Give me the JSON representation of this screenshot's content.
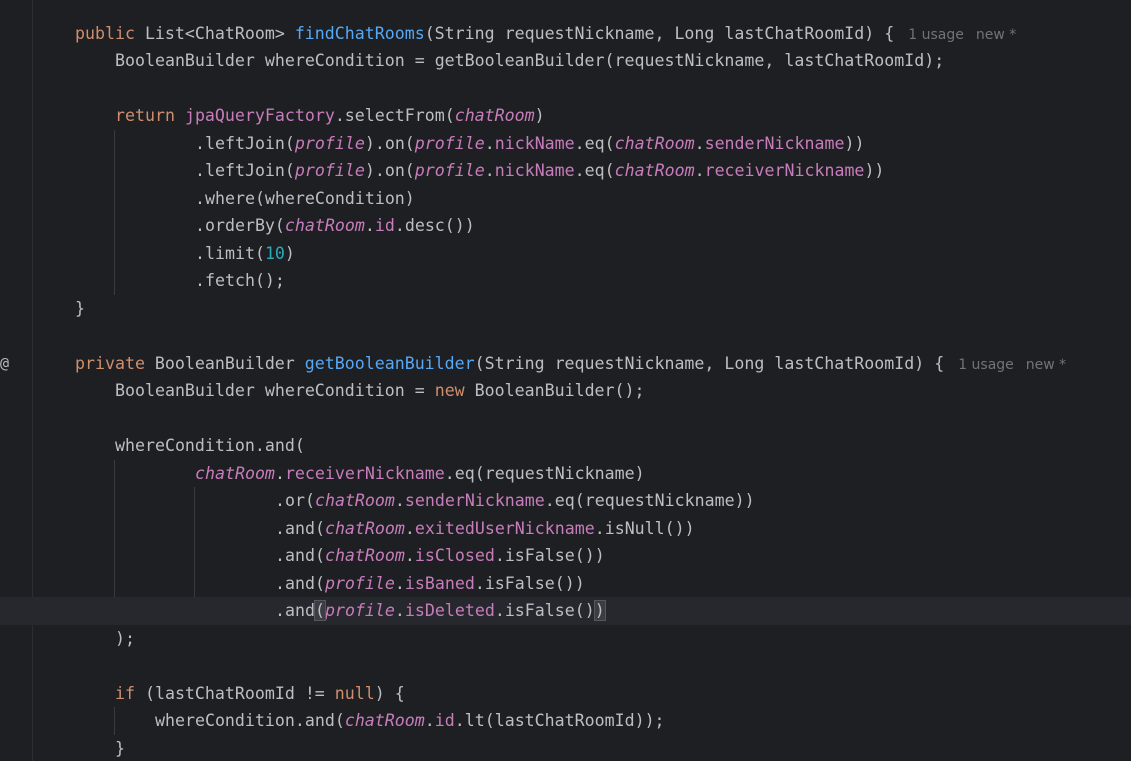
{
  "editor": {
    "gutter": {
      "at_icon": "@"
    },
    "lines": [
      [
        {
          "t": "public",
          "k": "kw"
        },
        {
          "t": " List<ChatRoom> ",
          "k": "tx"
        },
        {
          "t": "findChatRooms",
          "k": "fn"
        },
        {
          "t": "(String requestNickname, Long lastChatRoomId) {",
          "k": "tx"
        },
        {
          "t": "1 usage",
          "k": "hint"
        },
        {
          "t": "new *",
          "k": "hint"
        }
      ],
      [
        {
          "t": "BooleanBuilder whereCondition = getBooleanBuilder(requestNickname, lastChatRoomId);",
          "k": "tx"
        }
      ],
      [],
      [
        {
          "t": "return",
          "k": "kw"
        },
        {
          "t": " ",
          "k": "tx"
        },
        {
          "t": "jpaQueryFactory",
          "k": "fd"
        },
        {
          "t": ".selectFrom(",
          "k": "tx"
        },
        {
          "t": "chatRoom",
          "k": "st"
        },
        {
          "t": ")",
          "k": "tx"
        }
      ],
      [
        {
          "t": ".leftJoin(",
          "k": "tx"
        },
        {
          "t": "profile",
          "k": "st"
        },
        {
          "t": ").on(",
          "k": "tx"
        },
        {
          "t": "profile",
          "k": "st"
        },
        {
          "t": ".",
          "k": "tx"
        },
        {
          "t": "nickName",
          "k": "fd"
        },
        {
          "t": ".eq(",
          "k": "tx"
        },
        {
          "t": "chatRoom",
          "k": "st"
        },
        {
          "t": ".",
          "k": "tx"
        },
        {
          "t": "senderNickname",
          "k": "fd"
        },
        {
          "t": "))",
          "k": "tx"
        }
      ],
      [
        {
          "t": ".leftJoin(",
          "k": "tx"
        },
        {
          "t": "profile",
          "k": "st"
        },
        {
          "t": ").on(",
          "k": "tx"
        },
        {
          "t": "profile",
          "k": "st"
        },
        {
          "t": ".",
          "k": "tx"
        },
        {
          "t": "nickName",
          "k": "fd"
        },
        {
          "t": ".eq(",
          "k": "tx"
        },
        {
          "t": "chatRoom",
          "k": "st"
        },
        {
          "t": ".",
          "k": "tx"
        },
        {
          "t": "receiverNickname",
          "k": "fd"
        },
        {
          "t": "))",
          "k": "tx"
        }
      ],
      [
        {
          "t": ".where(whereCondition)",
          "k": "tx"
        }
      ],
      [
        {
          "t": ".orderBy(",
          "k": "tx"
        },
        {
          "t": "chatRoom",
          "k": "st"
        },
        {
          "t": ".",
          "k": "tx"
        },
        {
          "t": "id",
          "k": "fd"
        },
        {
          "t": ".desc())",
          "k": "tx"
        }
      ],
      [
        {
          "t": ".limit(",
          "k": "tx"
        },
        {
          "t": "10",
          "k": "num"
        },
        {
          "t": ")",
          "k": "tx"
        }
      ],
      [
        {
          "t": ".fetch();",
          "k": "tx"
        }
      ],
      [
        {
          "t": "}",
          "k": "tx"
        }
      ],
      [],
      [
        {
          "t": "private",
          "k": "kw"
        },
        {
          "t": " BooleanBuilder ",
          "k": "tx"
        },
        {
          "t": "getBooleanBuilder",
          "k": "fn"
        },
        {
          "t": "(String requestNickname, Long lastChatRoomId) {",
          "k": "tx"
        },
        {
          "t": "1 usage",
          "k": "hint"
        },
        {
          "t": "new *",
          "k": "hint"
        }
      ],
      [
        {
          "t": "BooleanBuilder whereCondition = ",
          "k": "tx"
        },
        {
          "t": "new",
          "k": "kw"
        },
        {
          "t": " BooleanBuilder();",
          "k": "tx"
        }
      ],
      [],
      [
        {
          "t": "whereCondition.and(",
          "k": "tx"
        }
      ],
      [
        {
          "t": "chatRoom",
          "k": "st"
        },
        {
          "t": ".",
          "k": "tx"
        },
        {
          "t": "receiverNickname",
          "k": "fd"
        },
        {
          "t": ".eq(requestNickname)",
          "k": "tx"
        }
      ],
      [
        {
          "t": ".or(",
          "k": "tx"
        },
        {
          "t": "chatRoom",
          "k": "st"
        },
        {
          "t": ".",
          "k": "tx"
        },
        {
          "t": "senderNickname",
          "k": "fd"
        },
        {
          "t": ".eq(requestNickname))",
          "k": "tx"
        }
      ],
      [
        {
          "t": ".and(",
          "k": "tx"
        },
        {
          "t": "chatRoom",
          "k": "st"
        },
        {
          "t": ".",
          "k": "tx"
        },
        {
          "t": "exitedUserNickname",
          "k": "fd"
        },
        {
          "t": ".isNull())",
          "k": "tx"
        }
      ],
      [
        {
          "t": ".and(",
          "k": "tx"
        },
        {
          "t": "chatRoom",
          "k": "st"
        },
        {
          "t": ".",
          "k": "tx"
        },
        {
          "t": "isClosed",
          "k": "fd"
        },
        {
          "t": ".isFalse())",
          "k": "tx"
        }
      ],
      [
        {
          "t": ".and(",
          "k": "tx"
        },
        {
          "t": "profile",
          "k": "st"
        },
        {
          "t": ".",
          "k": "tx"
        },
        {
          "t": "isBaned",
          "k": "fd"
        },
        {
          "t": ".isFalse())",
          "k": "tx"
        }
      ],
      [
        {
          "t": ".and",
          "k": "tx"
        },
        {
          "t": "(",
          "k": "brk"
        },
        {
          "t": "profile",
          "k": "st"
        },
        {
          "t": ".",
          "k": "tx"
        },
        {
          "t": "isDeleted",
          "k": "fd"
        },
        {
          "t": ".isFalse()",
          "k": "tx"
        },
        {
          "t": ")",
          "k": "brk"
        }
      ],
      [
        {
          "t": ");",
          "k": "tx"
        }
      ],
      [],
      [
        {
          "t": "if",
          "k": "kw"
        },
        {
          "t": " (lastChatRoomId != ",
          "k": "tx"
        },
        {
          "t": "null",
          "k": "kw"
        },
        {
          "t": ") {",
          "k": "tx"
        }
      ],
      [
        {
          "t": "whereCondition.and(",
          "k": "tx"
        },
        {
          "t": "chatRoom",
          "k": "st"
        },
        {
          "t": ".",
          "k": "tx"
        },
        {
          "t": "id",
          "k": "fd"
        },
        {
          "t": ".lt(lastChatRoomId));",
          "k": "tx"
        }
      ],
      [
        {
          "t": "}",
          "k": "tx"
        }
      ]
    ]
  }
}
